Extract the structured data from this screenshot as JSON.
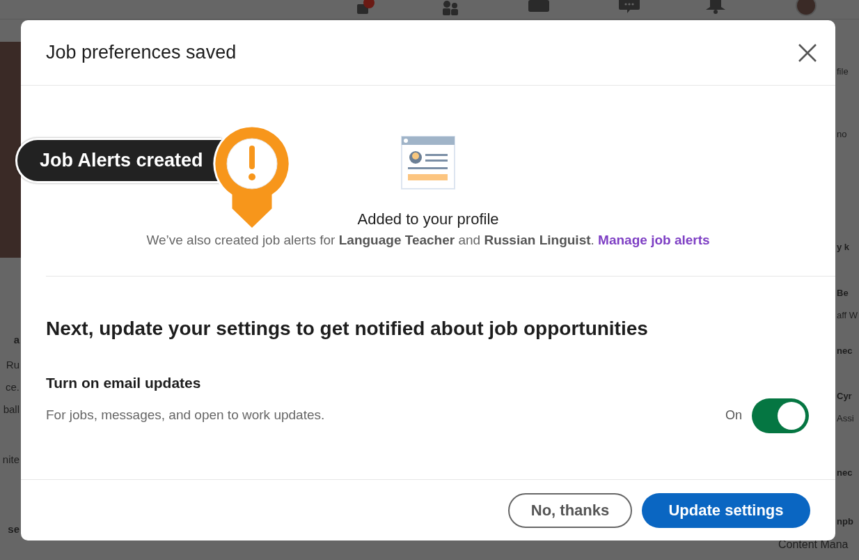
{
  "background": {
    "left_fragments": [
      {
        "text": "a",
        "bold": true
      },
      {
        "text": "Ru",
        "bold": false
      },
      {
        "text": "ce.",
        "bold": false
      },
      {
        "text": "ball",
        "bold": false
      },
      {
        "text": "nite",
        "bold": false
      },
      {
        "text": "se",
        "bold": true
      }
    ],
    "right_fragments": [
      {
        "text": "file",
        "bold": false
      },
      {
        "text": "no",
        "bold": false
      },
      {
        "text": "y k",
        "bold": true
      },
      {
        "text": "Be",
        "bold": true
      },
      {
        "text": "aff W",
        "bold": false
      },
      {
        "text": "nec",
        "bold": true
      },
      {
        "text": "Cyr",
        "bold": true
      },
      {
        "text": "Assi",
        "bold": false
      },
      {
        "text": "nec",
        "bold": true
      },
      {
        "text": "npb",
        "bold": true
      }
    ],
    "bottom_text": "Content Mana"
  },
  "dialog": {
    "title": "Job preferences saved",
    "callout": {
      "text": "Job Alerts created"
    },
    "added_title": "Added to your profile",
    "alerts_sentence": "We’ve also created job alerts for **Language Teacher** and **Russian Linguist**.",
    "alerts_link": "Manage job alerts",
    "settings_heading": "Next, update your settings to get notified about job opportunities",
    "setting": {
      "title": "Turn on email updates",
      "description": "For jobs, messages, and open to work updates.",
      "state_label": "On",
      "on": true
    },
    "buttons": [
      {
        "label": "No, thanks",
        "kind": "secondary"
      },
      {
        "label": "Update settings",
        "kind": "primary"
      }
    ]
  }
}
